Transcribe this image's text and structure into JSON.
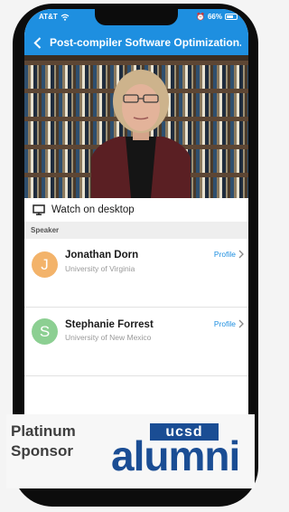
{
  "status_bar": {
    "carrier": "AT&T",
    "battery": "66%"
  },
  "nav": {
    "title": "Post-compiler Software Optimization..."
  },
  "video": {
    "icon": "play-video"
  },
  "watch": {
    "label": "Watch on desktop",
    "icon": "monitor-icon"
  },
  "section": {
    "label": "Speaker"
  },
  "speakers": [
    {
      "initial": "J",
      "name": "Jonathan Dorn",
      "affiliation": "University of Virginia",
      "avatar_color": "#f3b36a",
      "profile_label": "Profile"
    },
    {
      "initial": "S",
      "name": "Stephanie Forrest",
      "affiliation": "University of New Mexico",
      "avatar_color": "#8ccf92",
      "profile_label": "Profile"
    }
  ],
  "sponsor": {
    "line1": "Platinum",
    "line2": "Sponsor",
    "logo_top": "ucsd",
    "logo_bottom": "alumni"
  },
  "colors": {
    "accent": "#1e8fe0",
    "logo_blue": "#1a4d94"
  }
}
